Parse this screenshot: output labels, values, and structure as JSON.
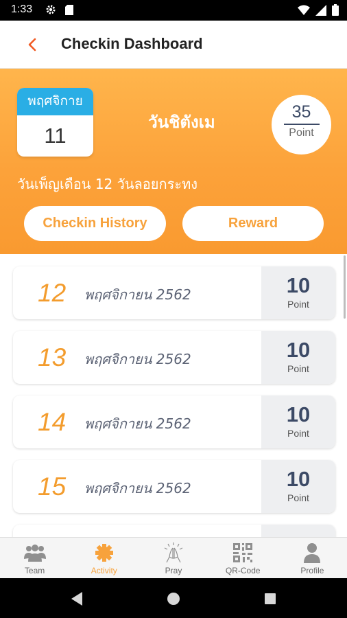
{
  "status_bar": {
    "time": "1:33",
    "icons": [
      "gear-icon",
      "sd-card-icon",
      "wifi-icon",
      "signal-icon",
      "battery-icon"
    ]
  },
  "app_bar": {
    "title": "Checkin Dashboard",
    "back_icon": "chevron-left-icon",
    "accent": "#f15a24"
  },
  "hero": {
    "calendar_month": "พฤศจิกาย",
    "calendar_day": "11",
    "day_name": "วันชิตังเม",
    "points_value": "35",
    "points_unit": "Point",
    "holiday_text": "วันเพ็ญเดือน 12 วันลอยกระทง",
    "history_label": "Checkin History",
    "reward_label": "Reward",
    "colors": {
      "orange": "#fca23a",
      "calendar_blue": "#2aaee5"
    }
  },
  "checkins": [
    {
      "day": "12",
      "date": "พฤศจิกายน 2562",
      "points": "10",
      "unit": "Point"
    },
    {
      "day": "13",
      "date": "พฤศจิกายน 2562",
      "points": "10",
      "unit": "Point"
    },
    {
      "day": "14",
      "date": "พฤศจิกายน 2562",
      "points": "10",
      "unit": "Point"
    },
    {
      "day": "15",
      "date": "พฤศจิกายน 2562",
      "points": "10",
      "unit": "Point"
    }
  ],
  "bottom_nav": [
    {
      "label": "Team",
      "icon": "team-icon",
      "active": false
    },
    {
      "label": "Activity",
      "icon": "activity-icon",
      "active": true
    },
    {
      "label": "Pray",
      "icon": "pray-icon",
      "active": false
    },
    {
      "label": "QR-Code",
      "icon": "qr-code-icon",
      "active": false
    },
    {
      "label": "Profile",
      "icon": "profile-icon",
      "active": false
    }
  ]
}
